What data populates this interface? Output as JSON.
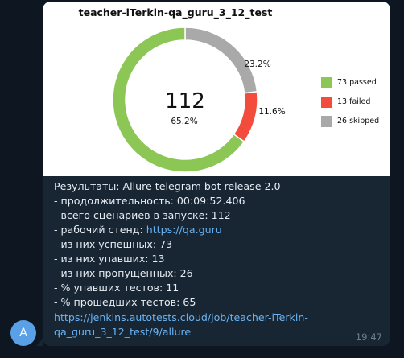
{
  "chart_data": {
    "type": "pie",
    "title": "teacher-iTerkin-qa_guru_3_12_test",
    "center_label": "112",
    "series": [
      {
        "name": "73 passed",
        "value": 73,
        "percent_label": "65.2%",
        "color": "#8cc756"
      },
      {
        "name": "13 failed",
        "value": 13,
        "percent_label": "11.6%",
        "color": "#f44c3c"
      },
      {
        "name": "26 skipped",
        "value": 26,
        "percent_label": "23.2%",
        "color": "#a9a9a9"
      }
    ],
    "legend_position": "right"
  },
  "message": {
    "lines": [
      "Результаты: Allure telegram bot release 2.0",
      "- продолжительность: 00:09:52.406",
      "- всего сценариев в запуске: 112"
    ],
    "stand_label": "- рабочий стенд: ",
    "stand_link": "https://qa.guru",
    "lines2": [
      "- из них успешных: 73",
      "- из них упавших: 13",
      "- из них пропущенных: 26",
      "- % упавших тестов: 11",
      "- % прошедших тестов: 65"
    ],
    "url_line1": "https://jenkins.autotests.cloud/job/teacher-iTerkin-",
    "url_line2": "qa_guru_3_12_test/9/allure",
    "time": "19:47"
  },
  "avatar_letter": "A"
}
